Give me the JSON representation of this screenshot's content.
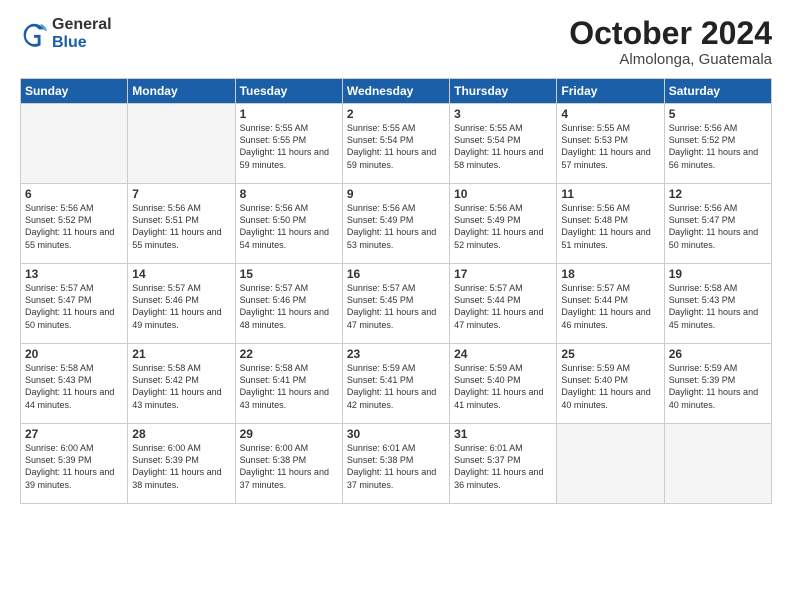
{
  "logo": {
    "general": "General",
    "blue": "Blue"
  },
  "title": "October 2024",
  "location": "Almolonga, Guatemala",
  "weekdays": [
    "Sunday",
    "Monday",
    "Tuesday",
    "Wednesday",
    "Thursday",
    "Friday",
    "Saturday"
  ],
  "weeks": [
    [
      {
        "day": "",
        "info": ""
      },
      {
        "day": "",
        "info": ""
      },
      {
        "day": "1",
        "info": "Sunrise: 5:55 AM\nSunset: 5:55 PM\nDaylight: 11 hours and 59 minutes."
      },
      {
        "day": "2",
        "info": "Sunrise: 5:55 AM\nSunset: 5:54 PM\nDaylight: 11 hours and 59 minutes."
      },
      {
        "day": "3",
        "info": "Sunrise: 5:55 AM\nSunset: 5:54 PM\nDaylight: 11 hours and 58 minutes."
      },
      {
        "day": "4",
        "info": "Sunrise: 5:55 AM\nSunset: 5:53 PM\nDaylight: 11 hours and 57 minutes."
      },
      {
        "day": "5",
        "info": "Sunrise: 5:56 AM\nSunset: 5:52 PM\nDaylight: 11 hours and 56 minutes."
      }
    ],
    [
      {
        "day": "6",
        "info": "Sunrise: 5:56 AM\nSunset: 5:52 PM\nDaylight: 11 hours and 55 minutes."
      },
      {
        "day": "7",
        "info": "Sunrise: 5:56 AM\nSunset: 5:51 PM\nDaylight: 11 hours and 55 minutes."
      },
      {
        "day": "8",
        "info": "Sunrise: 5:56 AM\nSunset: 5:50 PM\nDaylight: 11 hours and 54 minutes."
      },
      {
        "day": "9",
        "info": "Sunrise: 5:56 AM\nSunset: 5:49 PM\nDaylight: 11 hours and 53 minutes."
      },
      {
        "day": "10",
        "info": "Sunrise: 5:56 AM\nSunset: 5:49 PM\nDaylight: 11 hours and 52 minutes."
      },
      {
        "day": "11",
        "info": "Sunrise: 5:56 AM\nSunset: 5:48 PM\nDaylight: 11 hours and 51 minutes."
      },
      {
        "day": "12",
        "info": "Sunrise: 5:56 AM\nSunset: 5:47 PM\nDaylight: 11 hours and 50 minutes."
      }
    ],
    [
      {
        "day": "13",
        "info": "Sunrise: 5:57 AM\nSunset: 5:47 PM\nDaylight: 11 hours and 50 minutes."
      },
      {
        "day": "14",
        "info": "Sunrise: 5:57 AM\nSunset: 5:46 PM\nDaylight: 11 hours and 49 minutes."
      },
      {
        "day": "15",
        "info": "Sunrise: 5:57 AM\nSunset: 5:46 PM\nDaylight: 11 hours and 48 minutes."
      },
      {
        "day": "16",
        "info": "Sunrise: 5:57 AM\nSunset: 5:45 PM\nDaylight: 11 hours and 47 minutes."
      },
      {
        "day": "17",
        "info": "Sunrise: 5:57 AM\nSunset: 5:44 PM\nDaylight: 11 hours and 47 minutes."
      },
      {
        "day": "18",
        "info": "Sunrise: 5:57 AM\nSunset: 5:44 PM\nDaylight: 11 hours and 46 minutes."
      },
      {
        "day": "19",
        "info": "Sunrise: 5:58 AM\nSunset: 5:43 PM\nDaylight: 11 hours and 45 minutes."
      }
    ],
    [
      {
        "day": "20",
        "info": "Sunrise: 5:58 AM\nSunset: 5:43 PM\nDaylight: 11 hours and 44 minutes."
      },
      {
        "day": "21",
        "info": "Sunrise: 5:58 AM\nSunset: 5:42 PM\nDaylight: 11 hours and 43 minutes."
      },
      {
        "day": "22",
        "info": "Sunrise: 5:58 AM\nSunset: 5:41 PM\nDaylight: 11 hours and 43 minutes."
      },
      {
        "day": "23",
        "info": "Sunrise: 5:59 AM\nSunset: 5:41 PM\nDaylight: 11 hours and 42 minutes."
      },
      {
        "day": "24",
        "info": "Sunrise: 5:59 AM\nSunset: 5:40 PM\nDaylight: 11 hours and 41 minutes."
      },
      {
        "day": "25",
        "info": "Sunrise: 5:59 AM\nSunset: 5:40 PM\nDaylight: 11 hours and 40 minutes."
      },
      {
        "day": "26",
        "info": "Sunrise: 5:59 AM\nSunset: 5:39 PM\nDaylight: 11 hours and 40 minutes."
      }
    ],
    [
      {
        "day": "27",
        "info": "Sunrise: 6:00 AM\nSunset: 5:39 PM\nDaylight: 11 hours and 39 minutes."
      },
      {
        "day": "28",
        "info": "Sunrise: 6:00 AM\nSunset: 5:39 PM\nDaylight: 11 hours and 38 minutes."
      },
      {
        "day": "29",
        "info": "Sunrise: 6:00 AM\nSunset: 5:38 PM\nDaylight: 11 hours and 37 minutes."
      },
      {
        "day": "30",
        "info": "Sunrise: 6:01 AM\nSunset: 5:38 PM\nDaylight: 11 hours and 37 minutes."
      },
      {
        "day": "31",
        "info": "Sunrise: 6:01 AM\nSunset: 5:37 PM\nDaylight: 11 hours and 36 minutes."
      },
      {
        "day": "",
        "info": ""
      },
      {
        "day": "",
        "info": ""
      }
    ]
  ]
}
